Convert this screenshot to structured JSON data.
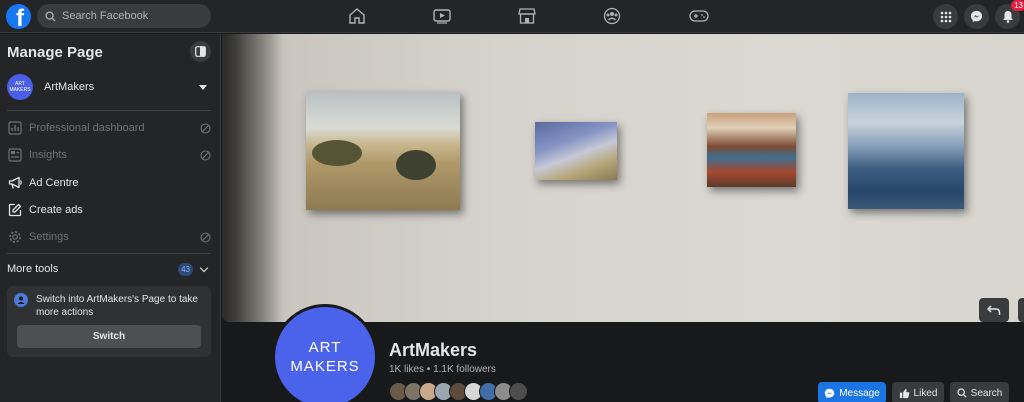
{
  "topbar": {
    "logo_letter": "f",
    "search_placeholder": "Search Facebook",
    "nav_icons": [
      "home-icon",
      "watch-icon",
      "marketplace-icon",
      "groups-icon",
      "gaming-icon"
    ],
    "notifications_count": "13"
  },
  "sidebar": {
    "title": "Manage Page",
    "page": {
      "name": "ArtMakers",
      "avatar_line1": "ART",
      "avatar_line2": "MAKERS"
    },
    "items": [
      {
        "label": "Professional dashboard",
        "icon": "dashboard-icon",
        "disabled": true
      },
      {
        "label": "Insights",
        "icon": "insights-icon",
        "disabled": true
      },
      {
        "label": "Ad Centre",
        "icon": "megaphone-icon",
        "disabled": false
      },
      {
        "label": "Create ads",
        "icon": "edit-icon",
        "disabled": false
      },
      {
        "label": "Settings",
        "icon": "gear-icon",
        "disabled": true
      }
    ],
    "more_tools": {
      "label": "More tools",
      "count": "43"
    },
    "switch_card": {
      "message": "Switch into ArtMakers's Page to take more actions",
      "button_label": "Switch"
    }
  },
  "profile": {
    "avatar_line1": "ART",
    "avatar_line2": "MAKERS",
    "name": "ArtMakers",
    "stats": "1K likes • 1.1K followers",
    "buttons": {
      "message": "Message",
      "liked": "Liked",
      "search": "Search"
    }
  },
  "colors": {
    "accent": "#1b74e4",
    "avatar": "#4b62ea",
    "badge": "#e41e3f"
  }
}
